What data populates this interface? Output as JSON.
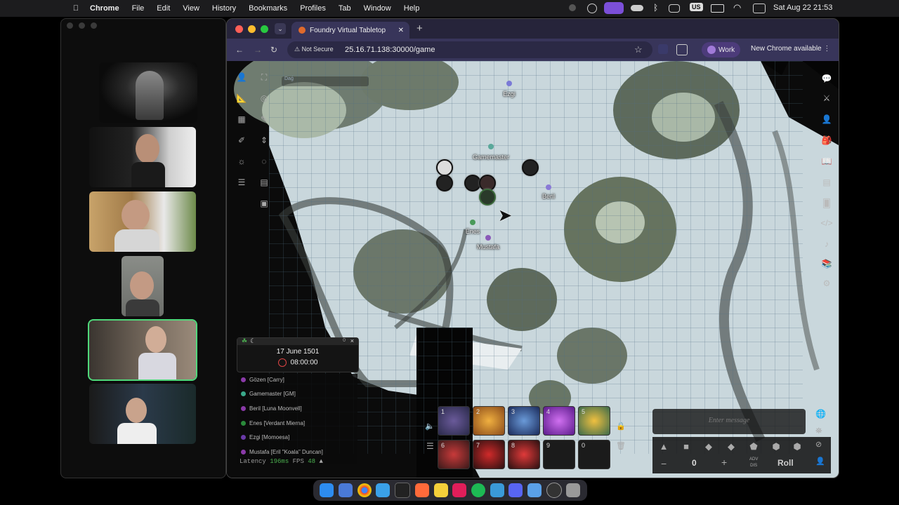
{
  "menubar": {
    "apple_icon": "apple-icon",
    "app": "Chrome",
    "items": [
      "File",
      "Edit",
      "View",
      "History",
      "Bookmarks",
      "Profiles",
      "Tab",
      "Window",
      "Help"
    ],
    "status_icons": [
      "record-icon",
      "screen-icon",
      "mirror-icon",
      "cloud-icon",
      "bluetooth-icon",
      "gamepad-icon",
      "input-source-icon",
      "battery-icon",
      "wifi-icon",
      "control-center-icon"
    ],
    "input_source": "US",
    "clock": "Sat Aug 22  21:53"
  },
  "browser": {
    "tab_title": "Foundry Virtual Tabletop",
    "not_secure": "Not Secure",
    "url": "25.16.71.138:30000/game",
    "profile": "Work",
    "new_chrome": "New Chrome available"
  },
  "scene": {
    "small_label": "Daǵ",
    "pings": [
      {
        "name": "Ezgi",
        "color": "#7a7ad6"
      },
      {
        "name": "Gamemaster",
        "color": "#5aa89a"
      },
      {
        "name": "Beril",
        "color": "#8a7ad6"
      },
      {
        "name": "Enes",
        "color": "#4a9a5a"
      },
      {
        "name": "Mustafa",
        "color": "#8a5ab8"
      }
    ]
  },
  "calendar": {
    "date": "17 June 1501",
    "time": "08:00:00",
    "badge": "0",
    "close": "×"
  },
  "players": [
    {
      "label": "Gözen [Carry]",
      "color": "#8a3aa8"
    },
    {
      "label": "Gamemaster [GM]",
      "color": "#3aa88a"
    },
    {
      "label": "Beril [Luna Moonvell]",
      "color": "#8a3aa8"
    },
    {
      "label": "Enes [Verdant Mierna]",
      "color": "#2a8a3a"
    },
    {
      "label": "Ezgi [Momoesa]",
      "color": "#6a3aa8"
    },
    {
      "label": "Mustafa [Eril \"Koala\" Duncan]",
      "color": "#8a3aa8"
    }
  ],
  "performance": {
    "latency_label": "Latency",
    "latency": "196ms",
    "fps_label": "FPS",
    "fps": "48"
  },
  "hotbar": {
    "slots": [
      "1",
      "2",
      "3",
      "4",
      "5",
      "6",
      "7",
      "8",
      "9",
      "0"
    ]
  },
  "chat": {
    "placeholder": "Enter message"
  },
  "dice": {
    "value": "0",
    "minus": "−",
    "plus": "+",
    "adv": "ADV",
    "dis": "DIS",
    "roll": "Roll"
  }
}
